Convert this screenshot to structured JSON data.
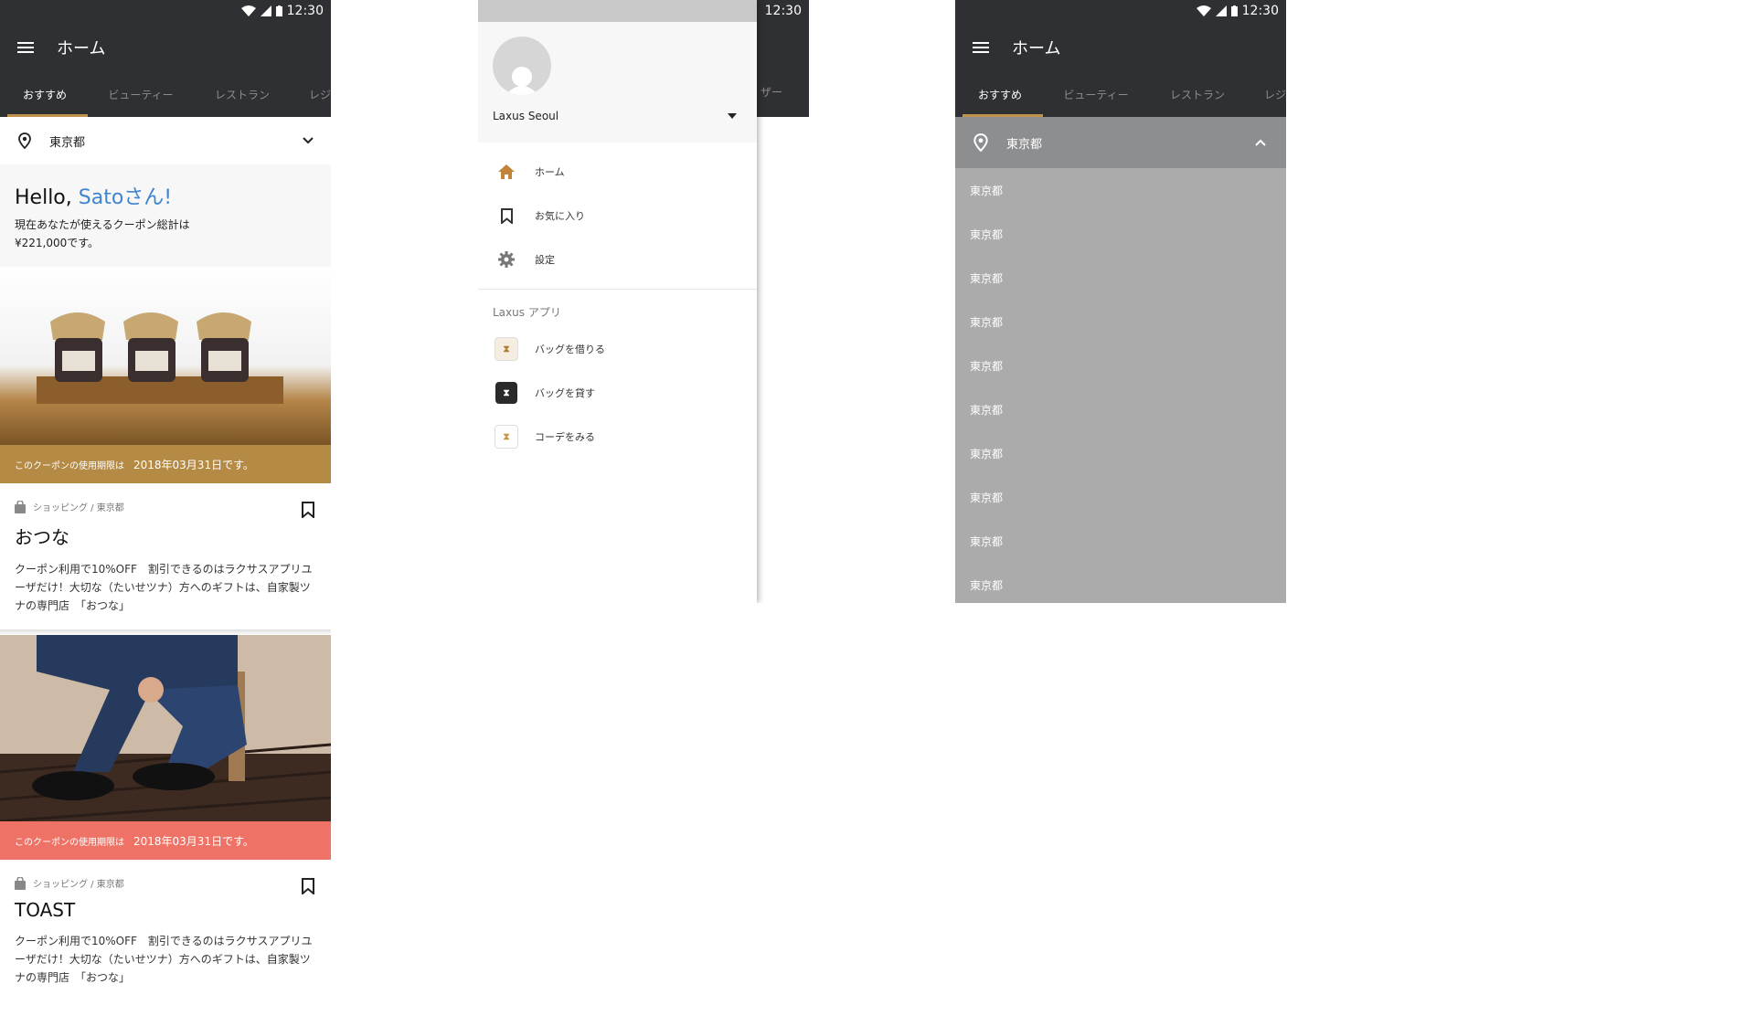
{
  "statusbar": {
    "time": "12:30"
  },
  "appbar": {
    "title": "ホーム"
  },
  "tabs": [
    {
      "label": "おすすめ",
      "active": true
    },
    {
      "label": "ビューティー",
      "active": false
    },
    {
      "label": "レストラン",
      "active": false
    },
    {
      "label": "レジ",
      "active": false
    }
  ],
  "location": {
    "label": "東京都"
  },
  "hello": {
    "greeting": "Hello,",
    "name": "Satoさん!",
    "line1": "現在あなたが使えるクーポン総計は",
    "line2": "¥221,000です。"
  },
  "cards": [
    {
      "coupon_prefix": "このクーポンの使用期限は",
      "coupon_date": "2018年03月31日です。",
      "coupon_color": "#b58a45",
      "meta": "ショッピング / 東京都",
      "title": "おつな",
      "desc": "クーポン利用で10%OFF　割引できるのはラクサスアプリユーザだけ！大切な（たいせツナ）方へのギフトは、自家製ツナの専門店　「おつな」"
    },
    {
      "coupon_prefix": "このクーポンの使用期限は",
      "coupon_date": "2018年03月31日です。",
      "coupon_color": "#ee7366",
      "meta": "ショッピング / 東京都",
      "title": "TOAST",
      "desc": "クーポン利用で10%OFF　割引できるのはラクサスアプリユーザだけ！大切な（たいせツナ）方へのギフトは、自家製ツナの専門店　「おつな」"
    }
  ],
  "drawer": {
    "account": "Laxus Seoul",
    "nav": [
      {
        "label": "ホーム",
        "icon": "home-icon"
      },
      {
        "label": "お気に入り",
        "icon": "bookmark-icon"
      },
      {
        "label": "設定",
        "icon": "gear-icon"
      }
    ],
    "apps_header": "Laxus アプリ",
    "apps": [
      {
        "label": "バッグを借りる",
        "icon": "laxus-borrow-icon"
      },
      {
        "label": "バッグを貸す",
        "icon": "laxus-lend-icon"
      },
      {
        "label": "コーデをみる",
        "icon": "laxus-coordinate-icon"
      }
    ],
    "behind_tab_fragment": "ザー"
  },
  "dropdown": {
    "selected": "東京都",
    "options": [
      "東京都",
      "東京都",
      "東京都",
      "東京都",
      "東京都",
      "東京都",
      "東京都",
      "東京都",
      "東京都",
      "東京都"
    ]
  },
  "colors": {
    "appbar": "#2f3033",
    "accent": "#c0924e",
    "link": "#3f84cf"
  }
}
